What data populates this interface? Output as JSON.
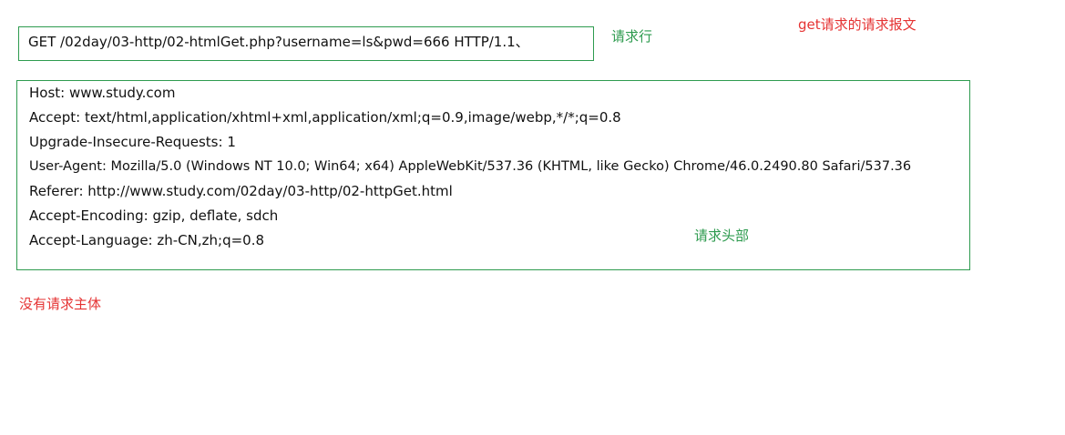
{
  "request_line": "GET /02day/03-http/02-htmlGet.php?username=ls&pwd=666 HTTP/1.1、",
  "request_line_label": "请求行",
  "title_label": "get请求的请求报文",
  "headers": [
    "Host: www.study.com",
    "Accept: text/html,application/xhtml+xml,application/xml;q=0.9,image/webp,*/*;q=0.8",
    "Upgrade-Insecure-Requests: 1",
    "User-Agent: Mozilla/5.0 (Windows NT 10.0; Win64; x64) AppleWebKit/537.36 (KHTML, like Gecko) Chrome/46.0.2490.80 Safari/537.36",
    "Referer: http://www.study.com/02day/03-http/02-httpGet.html",
    "Accept-Encoding: gzip, deflate, sdch",
    "Accept-Language: zh-CN,zh;q=0.8"
  ],
  "headers_label": "请求头部",
  "no_body_label": "没有请求主体",
  "colors": {
    "box_border": "#2e9b4f",
    "green_label": "#2e9b4f",
    "red_label": "#e53333",
    "text": "#111111"
  }
}
